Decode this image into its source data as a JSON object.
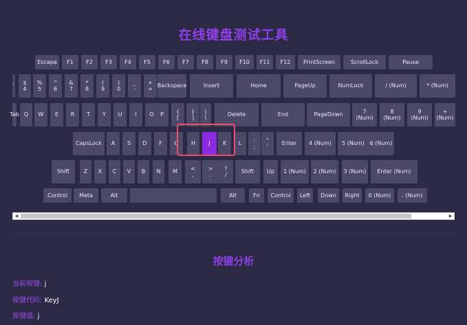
{
  "page_title": "在线键盘测试工具",
  "active_key": "J",
  "keyboard": {
    "rows": [
      [
        "Escape",
        "F1",
        "F2",
        "F3",
        "F4",
        "F5",
        "F6",
        "F7",
        "F8",
        "F9",
        "F10",
        "F11",
        "F12",
        "PrintScreen",
        "ScrollLock",
        "Pause"
      ],
      [
        "`",
        "$\n4",
        "%\n5",
        "^\n6",
        "&\n7",
        "*\n8",
        "(\n9",
        ")\n0",
        "_\n-",
        "+\n=",
        "Backspace",
        "Insert",
        "Home",
        "PageUp",
        "NumLock",
        "/ (Num)",
        "* (Num)"
      ],
      [
        "Tab",
        "Q",
        "W",
        "E",
        "R",
        "T",
        "Y",
        "U",
        "I",
        "O",
        "P",
        "{\n[",
        "}\n]",
        "|\n\\",
        "Delete",
        "End",
        "PageDown",
        "7\n(Num)",
        "8\n(Num)",
        "9\n(Num)",
        "+ (Num)"
      ],
      [
        "CapsLock",
        "A",
        "S",
        "D",
        "F",
        "G",
        "H",
        "J",
        "K",
        "L",
        ":\n;",
        "\"\n'",
        "Enter",
        "4 (Num)",
        "5 (Num)",
        "6 (Num)"
      ],
      [
        "Shift",
        "Z",
        "X",
        "C",
        "V",
        "B",
        "N",
        "M",
        "<\n,",
        ">\n.",
        "?\n/",
        "Shift",
        "Up",
        "1 (Num)",
        "2 (Num)",
        "3 (Num)",
        "Enter (Num)"
      ],
      [
        "Control",
        "Meta",
        "Alt",
        "",
        "Alt",
        "Fn",
        "Control",
        "Left",
        "Down",
        "Right",
        "0 (Num)",
        ". (Num)"
      ]
    ]
  },
  "analysis": {
    "title": "按键分析",
    "current_key_label": "当前按键:",
    "current_key_value": "j",
    "key_code_label": "按键代码:",
    "key_code_value": "KeyJ",
    "key_value_label": "按键值:",
    "key_value_value": "j"
  },
  "scrollbar": {
    "left_arrow": "◀",
    "right_arrow": "▶"
  },
  "colors": {
    "background": "#2b2944",
    "key": "#4b4868",
    "active_key": "#8a2be2",
    "accent": "#8f3fe6",
    "highlight_border": "#ec4e6f"
  }
}
